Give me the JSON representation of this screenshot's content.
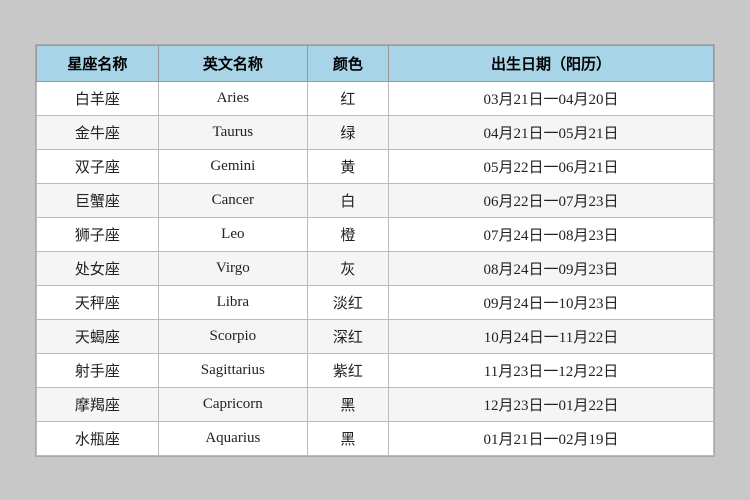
{
  "table": {
    "headers": [
      "星座名称",
      "英文名称",
      "颜色",
      "出生日期（阳历）"
    ],
    "rows": [
      {
        "chinese": "白羊座",
        "english": "Aries",
        "color": "红",
        "date": "03月21日一04月20日"
      },
      {
        "chinese": "金牛座",
        "english": "Taurus",
        "color": "绿",
        "date": "04月21日一05月21日"
      },
      {
        "chinese": "双子座",
        "english": "Gemini",
        "color": "黄",
        "date": "05月22日一06月21日"
      },
      {
        "chinese": "巨蟹座",
        "english": "Cancer",
        "color": "白",
        "date": "06月22日一07月23日"
      },
      {
        "chinese": "狮子座",
        "english": "Leo",
        "color": "橙",
        "date": "07月24日一08月23日"
      },
      {
        "chinese": "处女座",
        "english": "Virgo",
        "color": "灰",
        "date": "08月24日一09月23日"
      },
      {
        "chinese": "天秤座",
        "english": "Libra",
        "color": "淡红",
        "date": "09月24日一10月23日"
      },
      {
        "chinese": "天蝎座",
        "english": "Scorpio",
        "color": "深红",
        "date": "10月24日一11月22日"
      },
      {
        "chinese": "射手座",
        "english": "Sagittarius",
        "color": "紫红",
        "date": "11月23日一12月22日"
      },
      {
        "chinese": "摩羯座",
        "english": "Capricorn",
        "color": "黑",
        "date": "12月23日一01月22日"
      },
      {
        "chinese": "水瓶座",
        "english": "Aquarius",
        "color": "黑",
        "date": "01月21日一02月19日"
      }
    ]
  }
}
